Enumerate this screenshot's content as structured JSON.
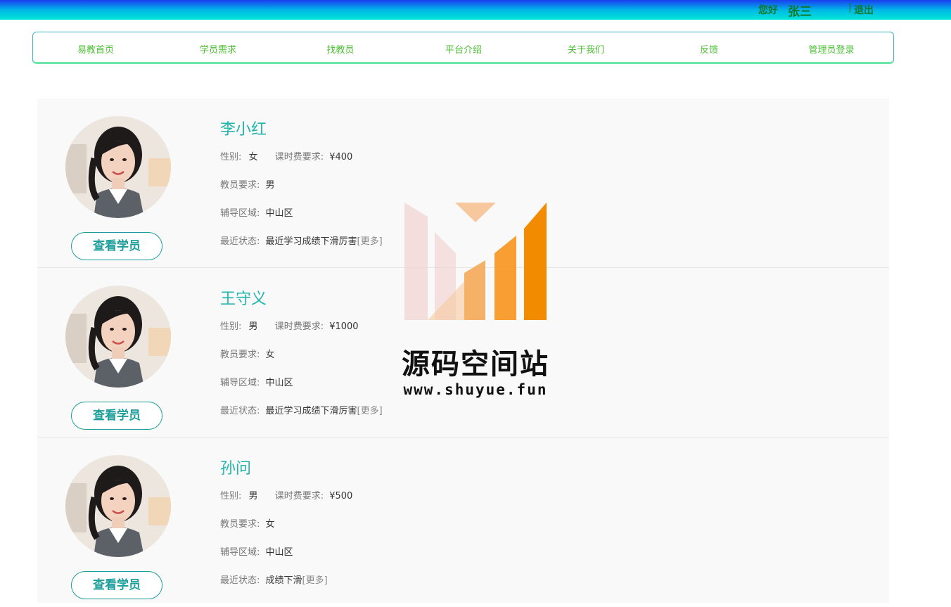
{
  "header": {
    "greeting": "您好",
    "username": "张三",
    "separator": "|",
    "logout": "退出"
  },
  "nav": {
    "items": [
      "易教首页",
      "学员需求",
      "找教员",
      "平台介绍",
      "关于我们",
      "反馈",
      "管理员登录"
    ]
  },
  "labels": {
    "gender": "性别:",
    "fee": "课时费要求:",
    "tutor_req": "教员要求:",
    "area": "辅导区域:",
    "status": "最近状态:",
    "more": "[更多]",
    "view_button": "查看学员"
  },
  "students": [
    {
      "name": "李小红",
      "gender": "女",
      "fee": "¥400",
      "tutor_req": "男",
      "area": "中山区",
      "status": "最近学习成绩下滑厉害"
    },
    {
      "name": "王守义",
      "gender": "男",
      "fee": "¥1000",
      "tutor_req": "女",
      "area": "中山区",
      "status": "最近学习成绩下滑厉害"
    },
    {
      "name": "孙问",
      "gender": "男",
      "fee": "¥500",
      "tutor_req": "女",
      "area": "中山区",
      "status": "成绩下滑"
    }
  ],
  "watermark": {
    "title": "源码空间站",
    "url": "www.shuyue.fun"
  },
  "colors": {
    "accent": "#1fb5ac",
    "nav_text": "#4cbf35",
    "header_text": "#10792c"
  }
}
